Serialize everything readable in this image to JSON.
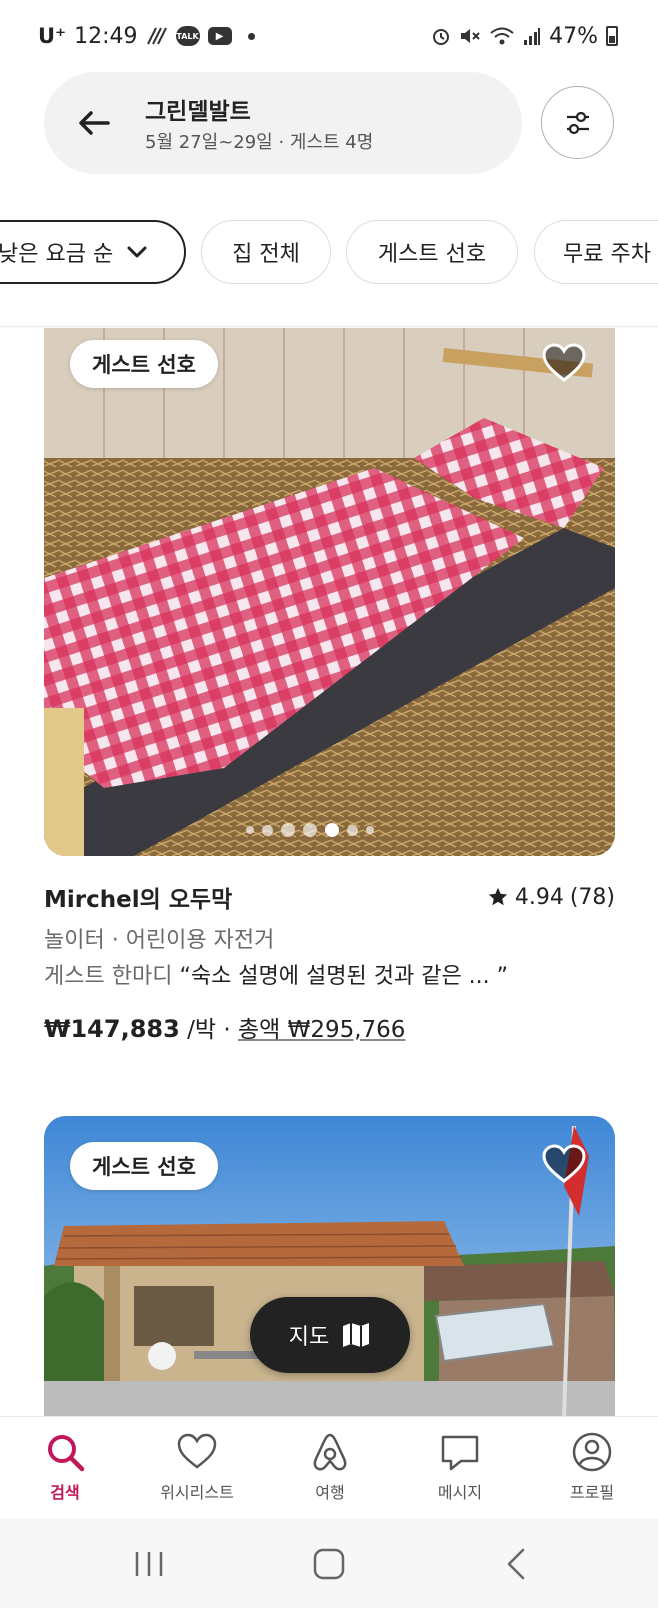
{
  "status_bar": {
    "carrier": "U⁺",
    "time": "12:49",
    "talk_icon_text": "TALK",
    "battery": "47%"
  },
  "search": {
    "title": "그린델발트",
    "subtitle": "5월 27일~29일 · 게스트 4명"
  },
  "chips": {
    "sort_label": "낮은 요금 순",
    "items": [
      "집 전체",
      "게스트 선호",
      "무료 주차"
    ]
  },
  "listings": [
    {
      "badge": "게스트 선호",
      "title": "Mirchel의 오두막",
      "rating": "4.94",
      "reviews": "(78)",
      "features": "놀이터 · 어린이용 자전거",
      "review_label": "게스트 한마디",
      "review_quote": "“숙소 설명에 설명된 것과 같은 ... ”",
      "price": "₩147,883",
      "per_night": "/박 · ",
      "total": "총액 ₩295,766",
      "photo_count": 6,
      "active_photo": 4
    },
    {
      "badge": "게스트 선호"
    }
  ],
  "map_button": {
    "label": "지도"
  },
  "tabs": [
    {
      "label": "검색",
      "icon": "search-icon",
      "active": true
    },
    {
      "label": "위시리스트",
      "icon": "heart-icon",
      "active": false
    },
    {
      "label": "여행",
      "icon": "airbnb-logo-icon",
      "active": false
    },
    {
      "label": "메시지",
      "icon": "message-icon",
      "active": false
    },
    {
      "label": "프로필",
      "icon": "profile-icon",
      "active": false
    }
  ],
  "colors": {
    "accent": "#c2185b",
    "text": "#222222",
    "muted": "#6a6a6a",
    "pill_bg": "#f2f2f2"
  }
}
